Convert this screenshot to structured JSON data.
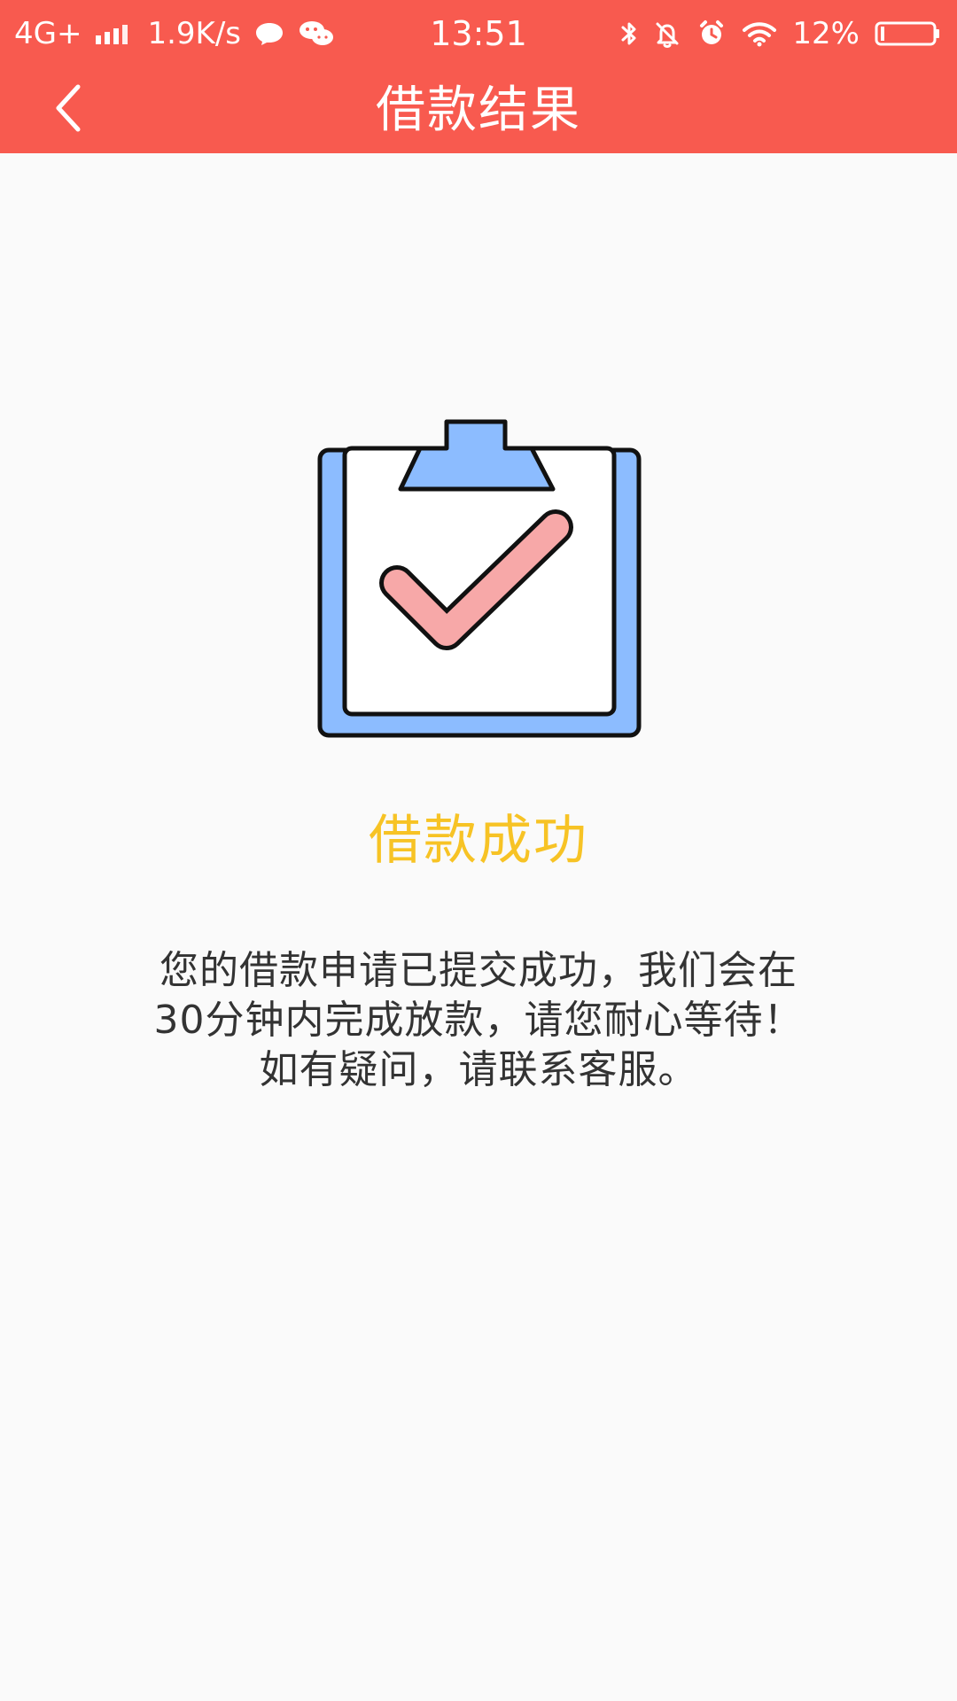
{
  "status_bar": {
    "network": "4G+",
    "speed": "1.9K/s",
    "time": "13:51",
    "battery": "12%"
  },
  "header": {
    "title": "借款结果"
  },
  "result": {
    "title": "借款成功",
    "message_lines": [
      "您的借款申请已提交成功，我们会在",
      "30分钟内完成放款，请您耐心等待！",
      "如有疑问，请联系客服。"
    ]
  },
  "colors": {
    "header_bg": "#f85a4f",
    "success_title": "#f7c325",
    "clipboard_blue": "#8cbcff",
    "check_pink": "#f7a8a8"
  }
}
